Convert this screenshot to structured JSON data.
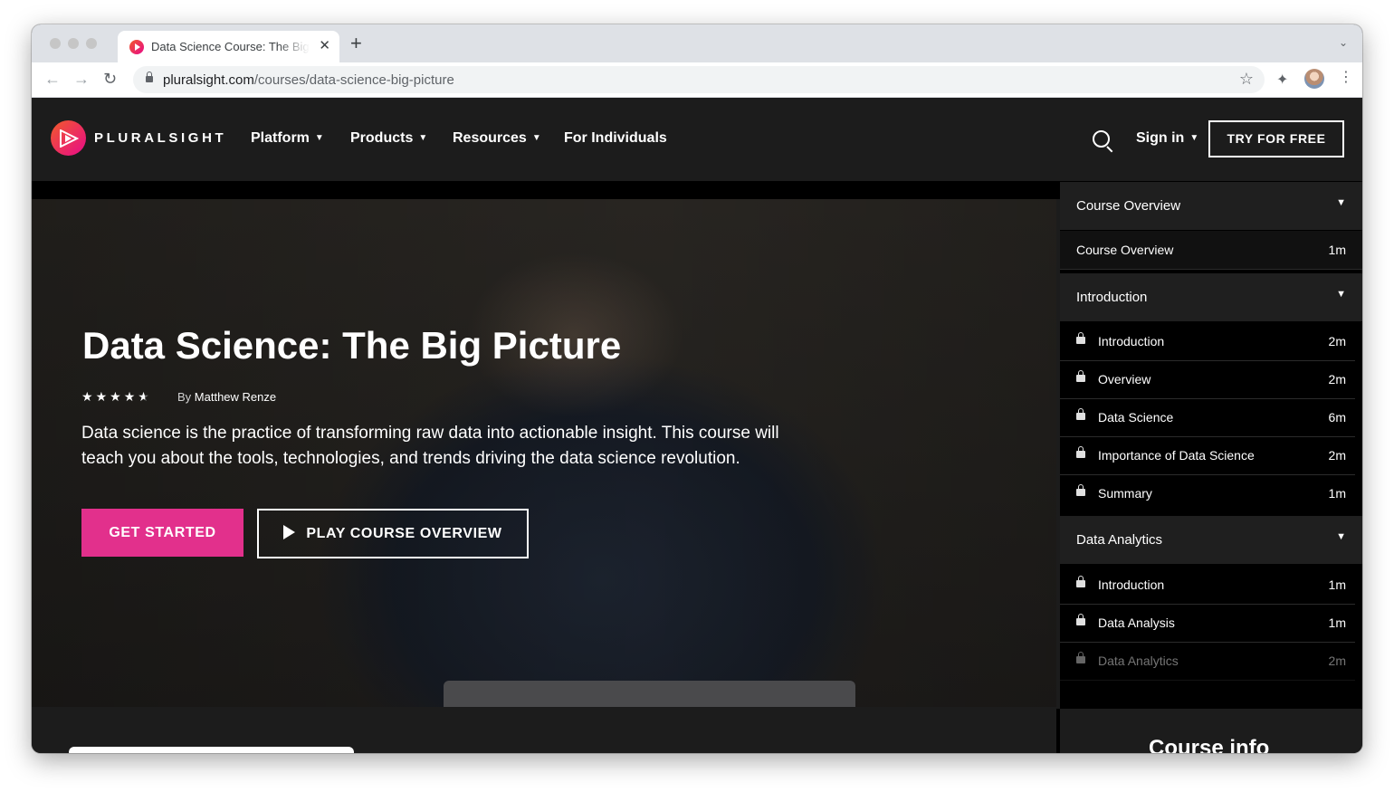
{
  "browser": {
    "tab_title": "Data Science Course: The Big Picture",
    "url_host": "pluralsight.com",
    "url_path": "/courses/data-science-big-picture",
    "icons": [
      "back-icon",
      "forward-icon",
      "reload-icon",
      "lock-icon",
      "star-icon",
      "extensions-icon",
      "profile-avatar",
      "more-icon"
    ]
  },
  "header": {
    "brand": "PLURALSIGHT",
    "nav": [
      "Platform",
      "Products",
      "Resources",
      "For Individuals"
    ],
    "sign_in": "Sign in",
    "cta": "TRY FOR FREE"
  },
  "hero": {
    "title": "Data Science: The Big Picture",
    "rating_stars": 4.5,
    "author_prefix": "By",
    "author": "Matthew Renze",
    "description": "Data science is the practice of transforming raw data into actionable insight. This course will teach you about the tools, technologies, and trends driving the data science revolution.",
    "primary_button": "GET STARTED",
    "secondary_button": "PLAY COURSE OVERVIEW"
  },
  "sidebar": {
    "modules": [
      {
        "title": "Course Overview",
        "clips": [
          {
            "title": "Course Overview",
            "duration": "1m",
            "locked": false
          }
        ]
      },
      {
        "title": "Introduction",
        "clips": [
          {
            "title": "Introduction",
            "duration": "2m",
            "locked": true
          },
          {
            "title": "Overview",
            "duration": "2m",
            "locked": true
          },
          {
            "title": "Data Science",
            "duration": "6m",
            "locked": true
          },
          {
            "title": "Importance of Data Science",
            "duration": "2m",
            "locked": true
          },
          {
            "title": "Summary",
            "duration": "1m",
            "locked": true
          }
        ]
      },
      {
        "title": "Data Analytics",
        "clips": [
          {
            "title": "Introduction",
            "duration": "1m",
            "locked": true
          },
          {
            "title": "Data Analysis",
            "duration": "1m",
            "locked": true
          },
          {
            "title": "Data Analytics",
            "duration": "2m",
            "locked": true
          }
        ]
      }
    ]
  },
  "bottom": {
    "course_info_heading": "Course info"
  },
  "colors": {
    "brand_pink": "#e2308c",
    "brand_orange": "#f15b2a",
    "header_bg": "#1c1c1c"
  }
}
